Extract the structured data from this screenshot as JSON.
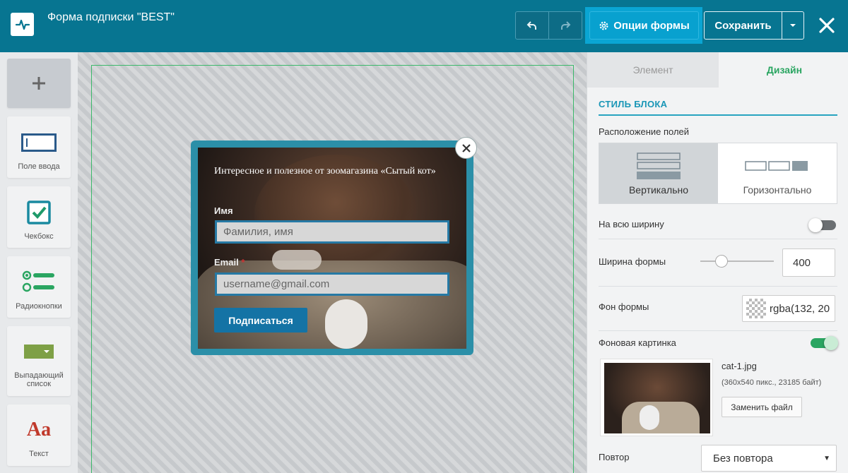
{
  "header": {
    "title": "Форма подписки \"BEST\"",
    "options_label": "Опции формы",
    "save_label": "Сохранить"
  },
  "toolbox": {
    "items": [
      {
        "label": "Поле ввода"
      },
      {
        "label": "Чекбокс"
      },
      {
        "label": "Радиокнопки"
      },
      {
        "label": "Выпадающий список"
      },
      {
        "label": "Текст"
      }
    ],
    "text_glyph": "Aa"
  },
  "form": {
    "title": "Интересное и полезное от зоомагазина «Сытый кот»",
    "name_label": "Имя",
    "name_placeholder": "Фамилия, имя",
    "email_label": "Email",
    "email_required_mark": "*",
    "email_value": "username@gmail.com",
    "submit_label": "Подписаться"
  },
  "panel": {
    "tabs": [
      {
        "label": "Элемент",
        "active": false
      },
      {
        "label": "Дизайн",
        "active": true
      }
    ],
    "section_title": "СТИЛЬ БЛОКА",
    "layout_label": "Расположение полей",
    "layout_options": [
      {
        "label": "Вертикально",
        "selected": true
      },
      {
        "label": "Горизонтально",
        "selected": false
      }
    ],
    "full_width_label": "На всю ширину",
    "full_width_on": false,
    "form_width_label": "Ширина формы",
    "form_width_value": "400",
    "bg_color_label": "Фон формы",
    "bg_color_value": "rgba(132, 20",
    "bg_image_label": "Фоновая картинка",
    "bg_image_on": true,
    "file_name": "cat-1.jpg",
    "file_info": "(360x540 пикс., 23185 байт)",
    "replace_label": "Заменить файл",
    "repeat_label": "Повтор",
    "repeat_value": "Без повтора"
  },
  "colors": {
    "header_bg": "#077591",
    "accent_blue": "#08a1cf",
    "accent_green": "#2aa561",
    "form_border": "#2b8fa8",
    "submit_bg": "#1473a5"
  }
}
